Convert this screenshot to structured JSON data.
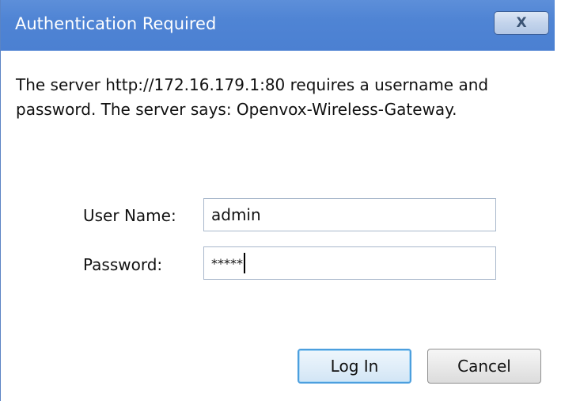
{
  "dialog": {
    "title": "Authentication Required",
    "close_label": "X",
    "message": "The server http://172.16.179.1:80 requires a username and password. The server says: Openvox-Wireless-Gateway."
  },
  "form": {
    "username_label": "User Name:",
    "username_value": "admin",
    "password_label": "Password:",
    "password_value": "*****"
  },
  "buttons": {
    "login_label": "Log In",
    "cancel_label": "Cancel"
  },
  "colors": {
    "titlebar": "#4f84d4",
    "login_border": "#4c9fde"
  }
}
